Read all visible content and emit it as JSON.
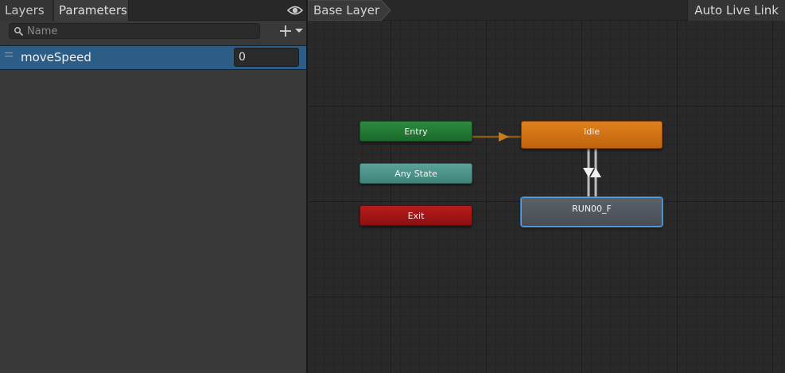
{
  "left_panel": {
    "tabs": [
      {
        "label": "Layers"
      },
      {
        "label": "Parameters"
      }
    ],
    "search": {
      "placeholder": "Name",
      "value": ""
    },
    "parameters": [
      {
        "name": "moveSpeed",
        "value": "0"
      }
    ]
  },
  "graph": {
    "breadcrumb": "Base Layer",
    "auto_live_link": "Auto Live Link",
    "states": {
      "entry": "Entry",
      "any_state": "Any State",
      "exit": "Exit",
      "idle": "Idle",
      "run": "RUN00_F"
    }
  },
  "colors": {
    "selected_row": "#2c5d87",
    "entry": "#1f7a33",
    "any_state": "#4a9188",
    "exit": "#a01515",
    "idle": "#d07216",
    "run": "#50565e",
    "selection_outline": "#5da0e0"
  },
  "icons": {
    "visibility": "eye-icon",
    "search": "search-icon",
    "add": "plus-icon",
    "dropdown": "triangle-down-icon"
  }
}
